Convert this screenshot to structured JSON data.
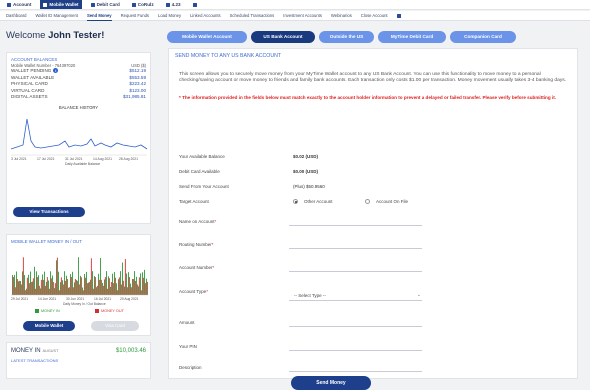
{
  "top_nav": [
    {
      "label": "Account",
      "active": false
    },
    {
      "label": "Mobile Wallet",
      "active": true
    },
    {
      "label": "Debit Card",
      "active": false
    },
    {
      "label": "CoRulz",
      "active": false
    },
    {
      "label": "4.23",
      "active": false
    }
  ],
  "sub_nav": [
    {
      "label": "Dashboard",
      "active": false
    },
    {
      "label": "Wallet ID Management",
      "active": false
    },
    {
      "label": "Send Money",
      "active": true
    },
    {
      "label": "Request Funds",
      "active": false
    },
    {
      "label": "Load Money",
      "active": false
    },
    {
      "label": "Linked Accounts",
      "active": false
    },
    {
      "label": "Scheduled Transactions",
      "active": false
    },
    {
      "label": "Investment Accounts",
      "active": false
    },
    {
      "label": "Webinarios",
      "active": false
    },
    {
      "label": "Close Account",
      "active": false
    }
  ],
  "welcome": {
    "prefix": "Welcome",
    "name": "John Tester!"
  },
  "balances": {
    "title": "ACCOUNT BALANCES",
    "wallet_number_label": "Mobile Wallet Number - 764397020",
    "currency": "USD ($)",
    "rows": [
      {
        "label": "WALLET PENDING",
        "value": "$512.19",
        "info": true
      },
      {
        "label": "WALLET AVAILABLE",
        "value": "$553.59",
        "info": false
      },
      {
        "label": "PHYSICAL CARD",
        "value": "$223.42",
        "info": false
      },
      {
        "label": "VIRTUAL CARD",
        "value": "$123.00",
        "info": false
      },
      {
        "label": "DIGITAL ASSETS",
        "value": "$31,985.81",
        "info": false
      }
    ],
    "chart_title": "BALANCE HISTORY",
    "chart_xticks": [
      "3 Jul 2021",
      "17 Jul 2021",
      "31 Jul 2021",
      "14 Aug 2021",
      "28 Aug 2021"
    ],
    "chart_xlabel": "Daily Available Balance",
    "view_button": "View Transactions"
  },
  "inout": {
    "title": "MOBILE WALLET MONEY IN / OUT",
    "xticks": [
      "29 Jul 2021",
      "14 Jun 2021",
      "30 Jun 2021",
      "16 Jul 2021",
      "20 Aug 2021"
    ],
    "xlabel": "Daily Money In / Out Balance",
    "legend_in": "MONEY IN",
    "legend_out": "MONEY OUT",
    "btn_mobile": "Mobile Wallet",
    "btn_virtual": "Visa Card",
    "colors": {
      "in": "#2e9a3a",
      "out": "#d23030"
    }
  },
  "money_in": {
    "label": "MONEY IN",
    "period": "AUGUST",
    "value": "$10,003.46",
    "latest": "LATEST TRANSACTIONS"
  },
  "tabs": [
    {
      "label": "Mobile Wallet Account",
      "active": false
    },
    {
      "label": "US Bank Account",
      "active": true
    },
    {
      "label": "Outside the US",
      "active": false
    },
    {
      "label": "MyTime Debit Card",
      "active": false
    },
    {
      "label": "Companion Card",
      "active": false
    }
  ],
  "form": {
    "title": "SEND MONEY TO ANY US BANK ACCOUNT",
    "description": "This screen allows you to securely move money from your MyTime Wallet account to any US Bank Account. You can use this functionality to move money to a personal checking/saving account or move money to friends and family bank accounts. Each transaction only costs $1.00 per transaction. Money movement usually takes 3-4 banking days.",
    "warning": "* The information provided in the fields below must match exactly to the account holder information to prevent a delayed or failed transfer. Please verify before submitting it.",
    "available_balance_label": "Your Available Balance",
    "available_balance_value": "$0.02 (USD)",
    "debit_card_label": "Debit Card Available",
    "debit_card_value": "$0.00 (USD)",
    "send_from_label": "Send From Your Account",
    "send_from_value": "(Plus) $50.9560",
    "target_label": "Target Account",
    "target_options": [
      "Other Account",
      "Account On File"
    ],
    "name_label": "Name on Account",
    "routing_label": "Routing Number",
    "account_label": "Account Number",
    "type_label": "Account Type",
    "type_placeholder": "-- Select Type --",
    "amount_label": "Amount",
    "pin_label": "Your PIN",
    "description_label": "Description",
    "submit": "Send Money"
  }
}
